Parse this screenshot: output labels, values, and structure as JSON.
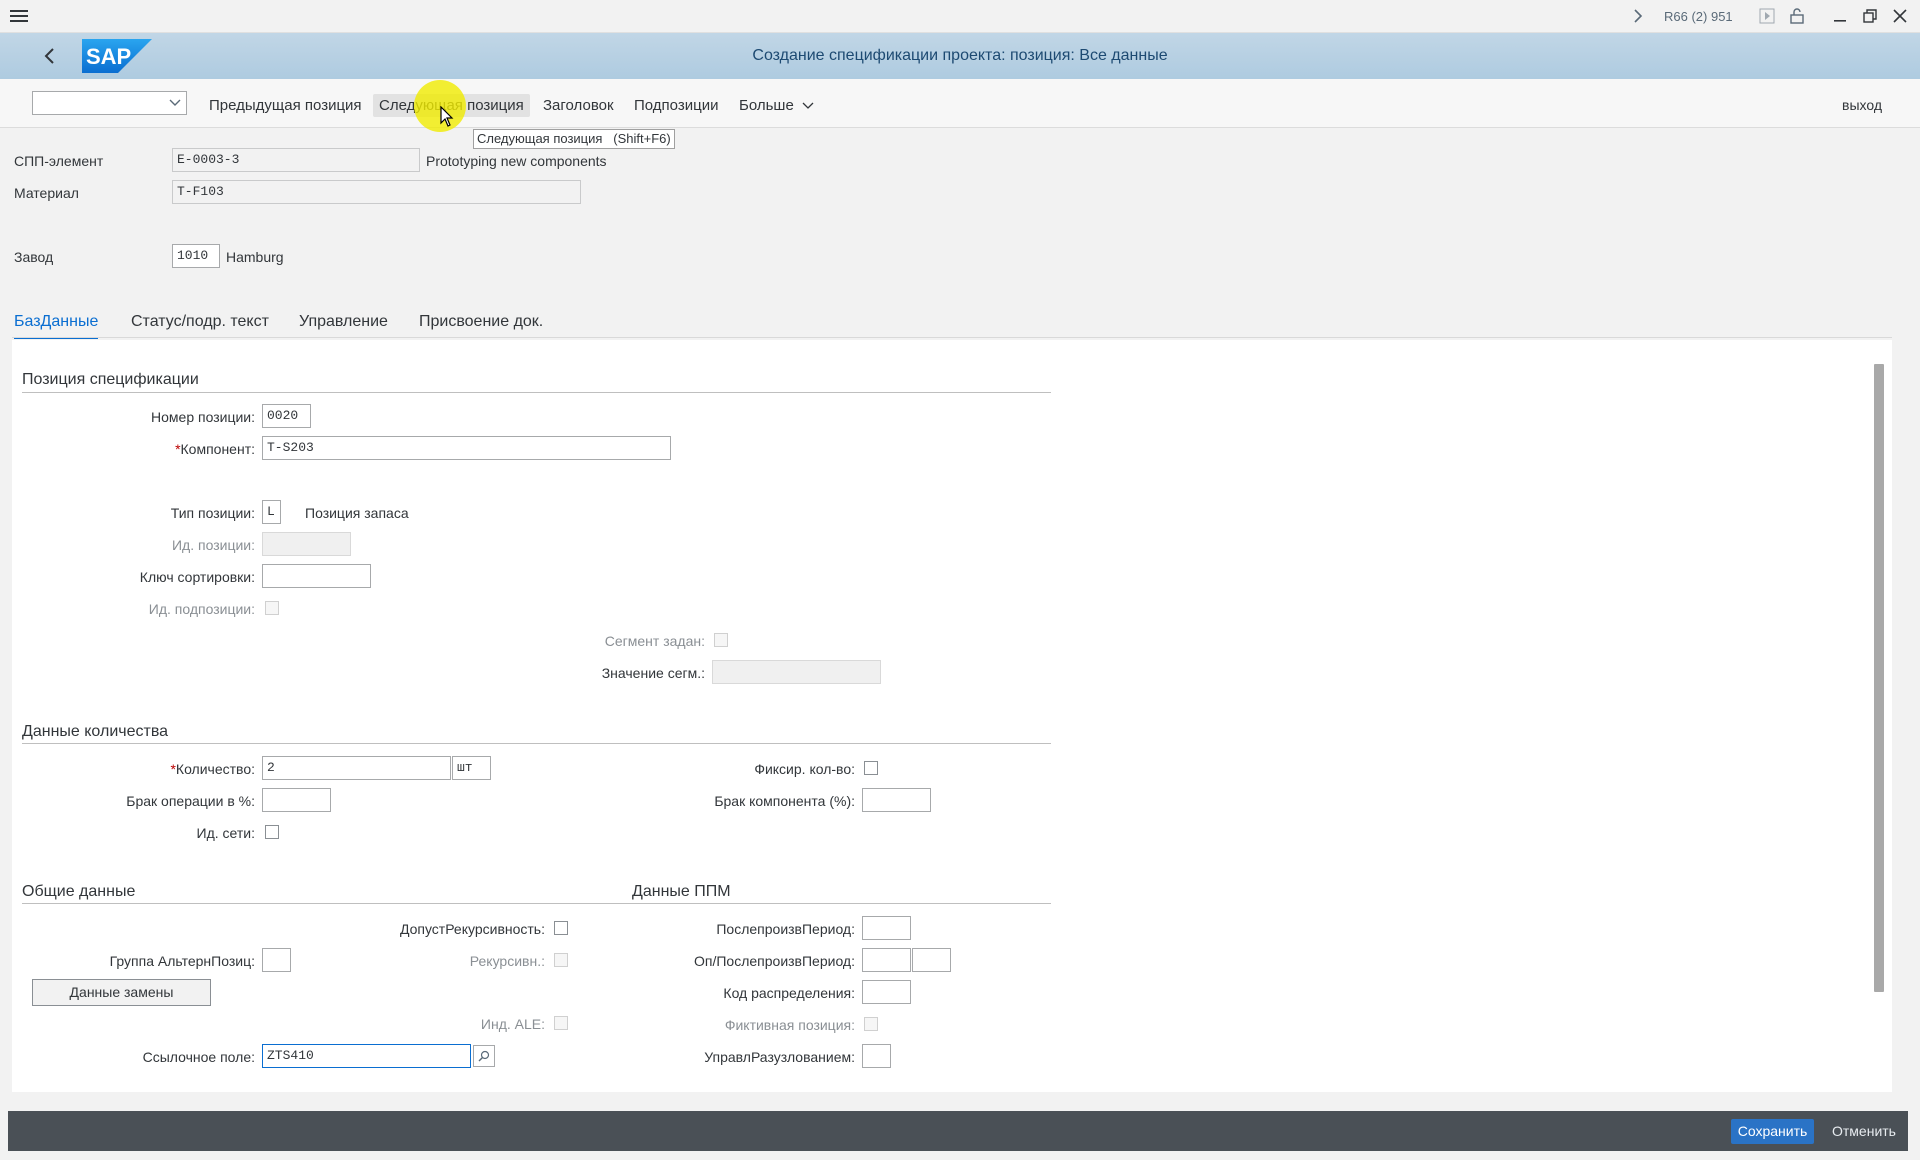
{
  "system": {
    "session": "R66 (2) 951"
  },
  "shell": {
    "title": "Создание спецификации проекта: позиция: Все данные",
    "logo": "SAP"
  },
  "toolbar": {
    "prev": "Предыдущая позиция",
    "next": "Следующая позиция",
    "header": "Заголовок",
    "subitems": "Подпозиции",
    "more": "Больше",
    "exit": "выход",
    "tooltip": "Следующая позиция   (Shift+F6)"
  },
  "header": {
    "wbs_label": "СПП-элемент",
    "wbs_value": "E-0003-3",
    "wbs_desc": "Prototyping new components",
    "material_label": "Материал",
    "material_value": "T-F103",
    "plant_label": "Завод",
    "plant_value": "1010",
    "plant_desc": "Hamburg"
  },
  "tabs": [
    "БазДанные",
    "Статус/подр. текст",
    "Управление",
    "Присвоение док."
  ],
  "item": {
    "section": "Позиция спецификации",
    "item_no_label": "Номер позиции:",
    "item_no": "0020",
    "component_label": "Компонент:",
    "component": "T-S203",
    "item_cat_label": "Тип позиции:",
    "item_cat": "L",
    "item_cat_desc": "Позиция запаса",
    "item_id_label": "Ид. позиции:",
    "sort_label": "Ключ сортировки:",
    "subitem_id_label": "Ид. подпозиции:",
    "segment_label": "Сегмент задан:",
    "segment_value_label": "Значение сегм.:"
  },
  "qty": {
    "section": "Данные количества",
    "qty_label": "Количество:",
    "qty": "2",
    "uom": "шт",
    "fixed_label": "Фиксир. кол-во:",
    "op_scrap_label": "Брак операции в %:",
    "comp_scrap_label": "Брак компонента (%):",
    "net_id_label": "Ид. сети:"
  },
  "general": {
    "section": "Общие данные",
    "recursive_allowed_label": "ДопустРекурсивность:",
    "alt_group_label": "Группа АльтернПозиц:",
    "recursive_label": "Рекурсивн.:",
    "replace_button": "Данные замены",
    "ale_label": "Инд. ALE:",
    "ref_label": "Ссылочное поле:",
    "ref_value": "ZTS410"
  },
  "mrp": {
    "section": "Данные ППМ",
    "lead_offset_label": "ПослепроизвПериод:",
    "op_lead_label": "Оп/ПослепроизвПериод:",
    "dist_key_label": "Код распределения:",
    "phantom_label": "Фиктивная позиция:",
    "explosion_label": "УправлРазузлованием:"
  },
  "footer": {
    "save": "Сохранить",
    "cancel": "Отменить"
  },
  "colors": {
    "accent": "#0a6ed1",
    "shell": "#b3cde0",
    "footer": "#4a5056"
  }
}
